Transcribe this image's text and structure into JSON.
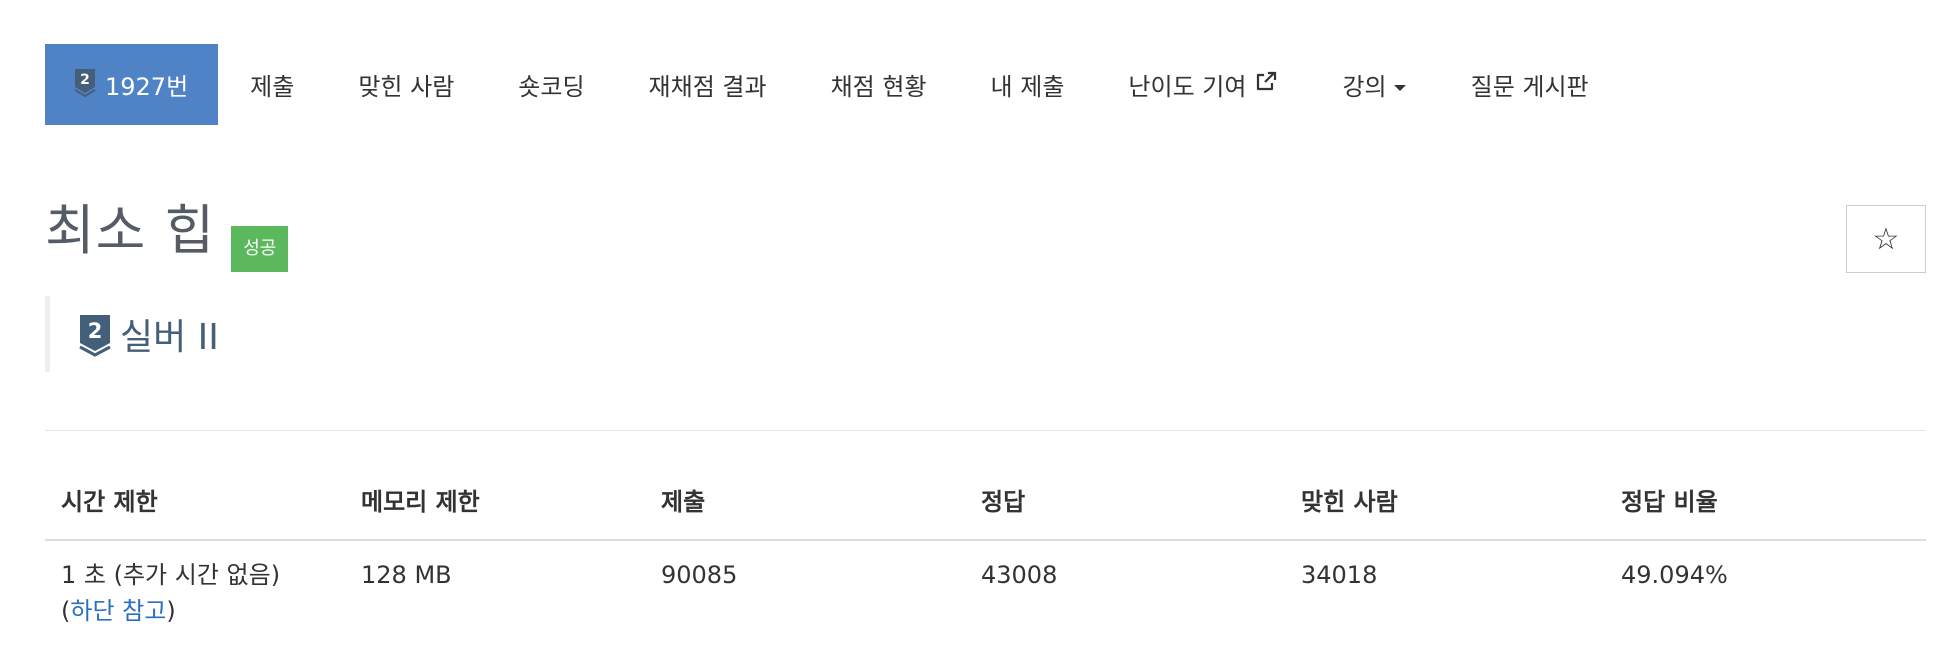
{
  "nav": {
    "active_problem": "1927번",
    "active_tier_level": "2",
    "tabs": [
      {
        "label": "제출"
      },
      {
        "label": "맞힌 사람"
      },
      {
        "label": "숏코딩"
      },
      {
        "label": "재채점 결과"
      },
      {
        "label": "채점 현황"
      },
      {
        "label": "내 제출"
      },
      {
        "label": "난이도 기여",
        "icon": "external-link-icon"
      },
      {
        "label": "강의",
        "icon": "caret-down-icon"
      },
      {
        "label": "질문 게시판"
      }
    ]
  },
  "problem": {
    "title": "최소 힙",
    "status_badge": "성공",
    "star_glyph": "☆",
    "tier_level": "2",
    "tier_name": "실버 II"
  },
  "info_table": {
    "headers": [
      "시간 제한",
      "메모리 제한",
      "제출",
      "정답",
      "맞힌 사람",
      "정답 비율"
    ],
    "time_limit_prefix": "1 초 (추가 시간 없음) (",
    "time_limit_link": "하단 참고",
    "time_limit_suffix": ")",
    "memory_limit": "128 MB",
    "submissions": "90085",
    "accepted": "43008",
    "solvers": "34018",
    "accept_ratio": "49.094%"
  },
  "colors": {
    "active_tab_bg": "#5083c6",
    "badge_success": "#5cb85c",
    "tier_silver": "#435f7a",
    "link": "#2a6fc0"
  }
}
